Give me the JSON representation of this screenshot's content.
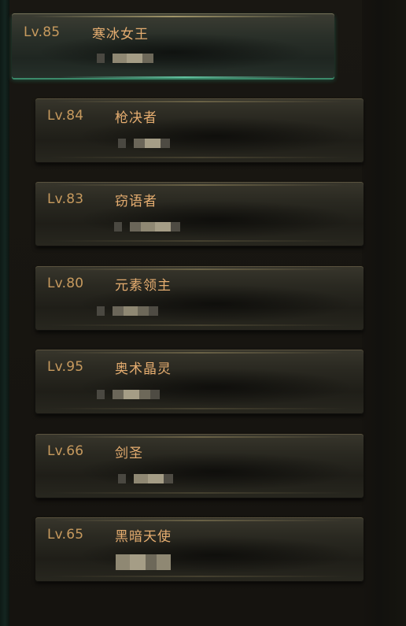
{
  "characters": [
    {
      "level": "Lv.85",
      "class": "寒冰女王",
      "name": "",
      "selected": true
    },
    {
      "level": "Lv.84",
      "class": "枪决者",
      "name": ""
    },
    {
      "level": "Lv.83",
      "class": "窃语者",
      "name": ""
    },
    {
      "level": "Lv.80",
      "class": "元素领主",
      "name": ""
    },
    {
      "level": "Lv.95",
      "class": "奥术晶灵",
      "name": ""
    },
    {
      "level": "Lv.66",
      "class": "剑圣",
      "name": ""
    },
    {
      "level": "Lv.65",
      "class": "黑暗天使",
      "name": ""
    }
  ]
}
